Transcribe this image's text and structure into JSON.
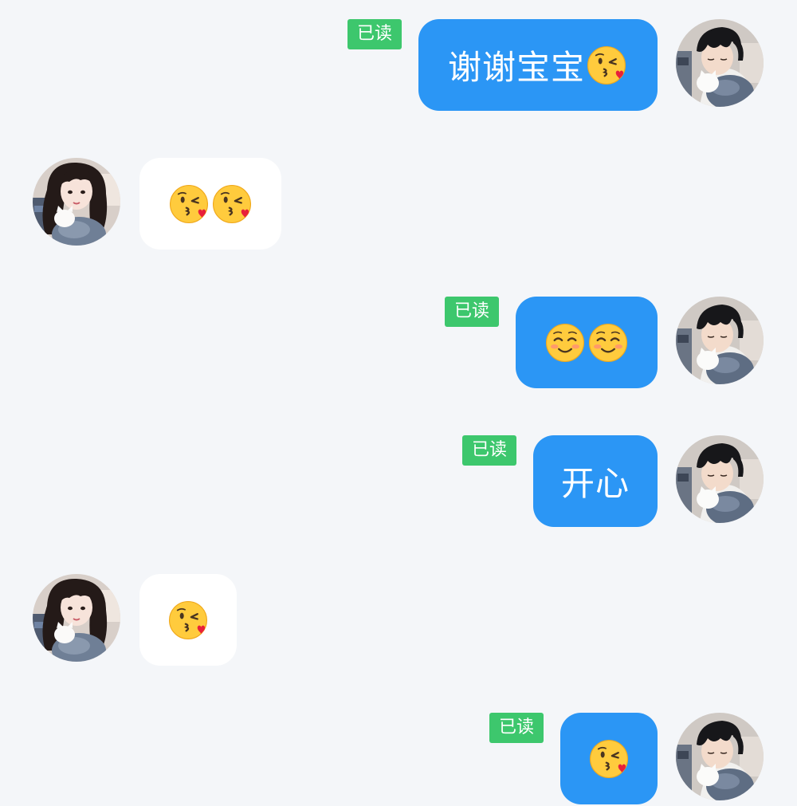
{
  "chat": {
    "read_label": "已读",
    "messages": [
      {
        "from": "me",
        "text": "谢谢宝宝",
        "emoji": [
          "kissing-wink"
        ],
        "read": true
      },
      {
        "from": "them",
        "text": "",
        "emoji": [
          "kissing-wink",
          "kissing-wink"
        ]
      },
      {
        "from": "me",
        "text": "",
        "emoji": [
          "smiling-blush",
          "smiling-blush"
        ],
        "read": true
      },
      {
        "from": "me",
        "text": "开心",
        "emoji": [],
        "read": true
      },
      {
        "from": "them",
        "text": "",
        "emoji": [
          "kissing-wink"
        ]
      },
      {
        "from": "me",
        "text": "",
        "emoji": [
          "kissing-wink"
        ],
        "read": true
      }
    ]
  },
  "colors": {
    "background": "#f4f6f9",
    "my_bubble": "#2b96f5",
    "their_bubble": "#ffffff",
    "read_badge": "#3dc76d"
  },
  "avatars": {
    "me": "avatar-boy-photo",
    "them": "avatar-girl-photo"
  }
}
